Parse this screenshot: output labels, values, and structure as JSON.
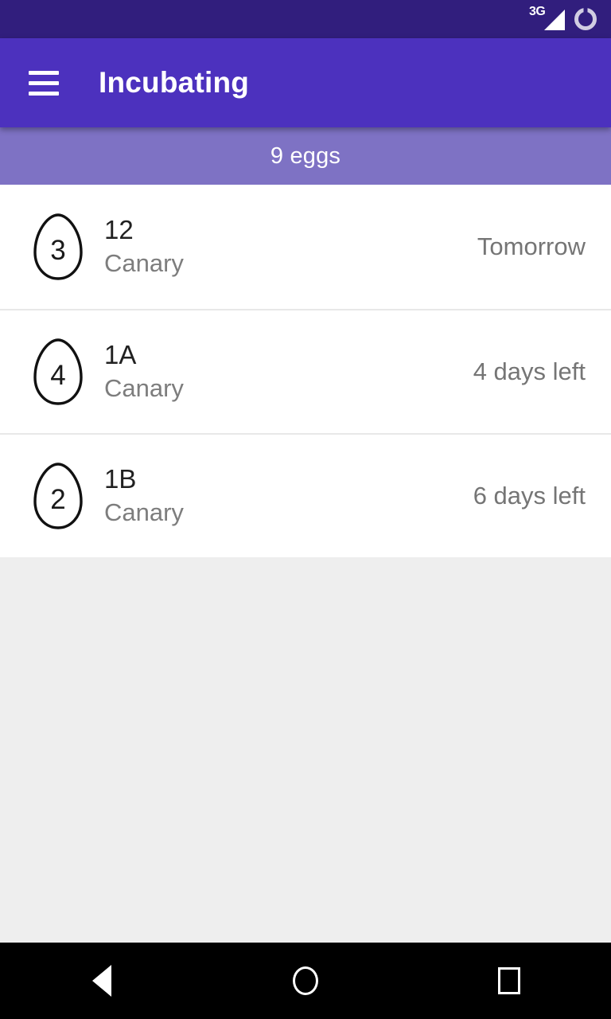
{
  "status_bar": {
    "network_label": "3G",
    "background": "#311e7d",
    "icons": [
      "signal-icon",
      "battery-icon"
    ]
  },
  "app_bar": {
    "title": "Incubating",
    "menu_icon": "hamburger-menu-icon",
    "background": "#4c31be"
  },
  "subheader": {
    "text": "9 eggs",
    "background": "#7e72c4"
  },
  "list": {
    "items": [
      {
        "count": "3",
        "primary": "12",
        "secondary": "Canary",
        "meta": "Tomorrow"
      },
      {
        "count": "4",
        "primary": "1A",
        "secondary": "Canary",
        "meta": "4 days left"
      },
      {
        "count": "2",
        "primary": "1B",
        "secondary": "Canary",
        "meta": "6 days left"
      }
    ]
  },
  "nav_bar": {
    "back_label": "Back",
    "home_label": "Home",
    "recents_label": "Recents",
    "background": "#000000"
  },
  "colors": {
    "primary_dark": "#311e7d",
    "primary": "#4c31be",
    "subheader": "#7e72c4",
    "page_background": "#eeeeee",
    "text_primary": "#212121",
    "text_secondary": "#757575"
  }
}
